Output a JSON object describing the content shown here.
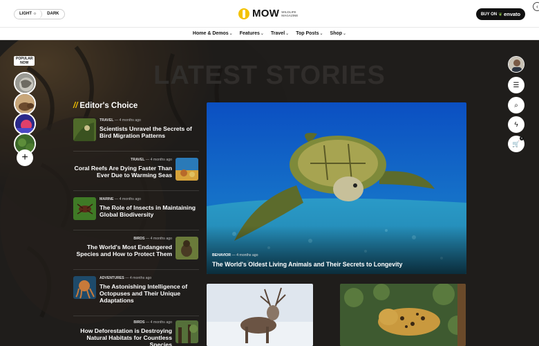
{
  "header": {
    "theme_light": "LIGHT ☼",
    "theme_dark": "DARK",
    "logo_word": "MOW",
    "logo_sub_1": "WILDLIFE",
    "logo_sub_2": "MAGAZINE",
    "buy_prefix": "BUY ON",
    "buy_brand": "envato",
    "corner_glyph": "‹"
  },
  "nav": {
    "items": [
      {
        "label": "Home & Demos"
      },
      {
        "label": "Features"
      },
      {
        "label": "Travel"
      },
      {
        "label": "Top Posts"
      },
      {
        "label": "Shop"
      }
    ],
    "chevron": "⌄"
  },
  "hero": {
    "title": "LATEST STORIES"
  },
  "popular": {
    "tag_1": "POPULAR",
    "tag_2": "NOW",
    "plus": "+"
  },
  "rail": {
    "menu_icon": "☰",
    "search_icon": "⌕",
    "bolt_icon": "ϟ",
    "cart_icon": "🛒",
    "cart_count": "0"
  },
  "editors_choice": {
    "slashes": "//",
    "title": "Editor's Choice",
    "items": [
      {
        "category": "TRAVEL",
        "time": "4 months ago",
        "headline": "Scientists Unravel the Secrets of Bird Migration Patterns"
      },
      {
        "category": "TRAVEL",
        "time": "4 months ago",
        "headline": "Coral Reefs Are Dying Faster Than Ever Due to Warming Seas"
      },
      {
        "category": "MARINE",
        "time": "4 months ago",
        "headline": "The Role of Insects in Maintaining Global Biodiversity"
      },
      {
        "category": "BIRDS",
        "time": "4 months ago",
        "headline": "The World's Most Endangered Species and How to Protect Them"
      },
      {
        "category": "ADVENTURES",
        "time": "4 months ago",
        "headline": "The Astonishing Intelligence of Octopuses and Their Unique Adaptations"
      },
      {
        "category": "BIRDS",
        "time": "4 months ago",
        "headline": "How Deforestation is Destroying Natural Habitats for Countless Species"
      }
    ],
    "dash": "—"
  },
  "feature": {
    "category": "BEHAVIOR",
    "time": "4 months ago",
    "title": "The World's Oldest Living Animals and Their Secrets to Longevity"
  }
}
